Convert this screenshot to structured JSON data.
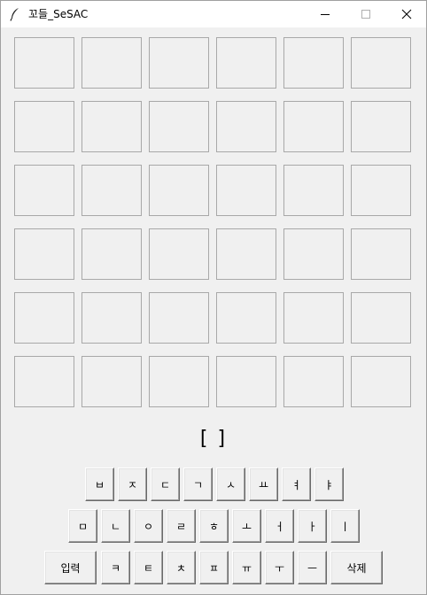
{
  "window": {
    "title": "꼬들_SeSAC",
    "icon": "feather-icon",
    "controls": [
      "minimize-icon",
      "maximize-icon",
      "close-icon"
    ]
  },
  "board": {
    "rows": 6,
    "cols": 6,
    "cells": [
      [
        "",
        "",
        "",
        "",
        "",
        ""
      ],
      [
        "",
        "",
        "",
        "",
        "",
        ""
      ],
      [
        "",
        "",
        "",
        "",
        "",
        ""
      ],
      [
        "",
        "",
        "",
        "",
        "",
        ""
      ],
      [
        "",
        "",
        "",
        "",
        "",
        ""
      ],
      [
        "",
        "",
        "",
        "",
        "",
        ""
      ]
    ]
  },
  "input_display": "[ ]",
  "keyboard": {
    "row1": [
      "ㅂ",
      "ㅈ",
      "ㄷ",
      "ㄱ",
      "ㅅ",
      "ㅛ",
      "ㅕ",
      "ㅑ"
    ],
    "row2": [
      "ㅁ",
      "ㄴ",
      "ㅇ",
      "ㄹ",
      "ㅎ",
      "ㅗ",
      "ㅓ",
      "ㅏ",
      "ㅣ"
    ],
    "row3_enter": "입력",
    "row3": [
      "ㅋ",
      "ㅌ",
      "ㅊ",
      "ㅍ",
      "ㅠ",
      "ㅜ",
      "ㅡ"
    ],
    "row3_delete": "삭제"
  }
}
